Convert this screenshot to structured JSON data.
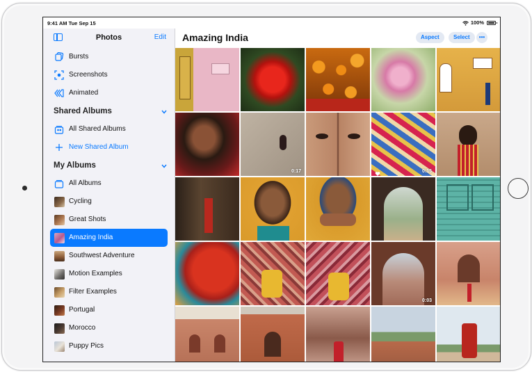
{
  "status": {
    "time": "9:41 AM",
    "date": "Tue Sep 15",
    "battery": "100%"
  },
  "sidebar": {
    "title": "Photos",
    "edit": "Edit",
    "top_items": [
      {
        "label": "Bursts",
        "icon": "bursts-icon"
      },
      {
        "label": "Screenshots",
        "icon": "screenshots-icon"
      },
      {
        "label": "Animated",
        "icon": "animated-icon"
      }
    ],
    "shared_section": {
      "label": "Shared Albums"
    },
    "shared_items": [
      {
        "label": "All Shared Albums",
        "icon": "shared-albums-icon"
      },
      {
        "label": "New Shared Album",
        "icon": "plus-icon"
      }
    ],
    "my_section": {
      "label": "My Albums"
    },
    "my_items": [
      {
        "label": "All Albums",
        "icon": "albums-icon"
      },
      {
        "label": "Cycling"
      },
      {
        "label": "Great Shots"
      },
      {
        "label": "Amazing India",
        "selected": true
      },
      {
        "label": "Southwest Adventure"
      },
      {
        "label": "Motion Examples"
      },
      {
        "label": "Filter Examples"
      },
      {
        "label": "Portugal"
      },
      {
        "label": "Morocco"
      },
      {
        "label": "Puppy Pics"
      }
    ]
  },
  "main": {
    "title": "Amazing India",
    "aspect": "Aspect",
    "select": "Select",
    "more": "•••",
    "durations": [
      "0:17",
      "0:15",
      "0:03"
    ]
  },
  "colors": {
    "accent": "#0a7aff",
    "sidebar_bg": "#f2f2f7",
    "pill_bg": "#e3e9f3"
  }
}
